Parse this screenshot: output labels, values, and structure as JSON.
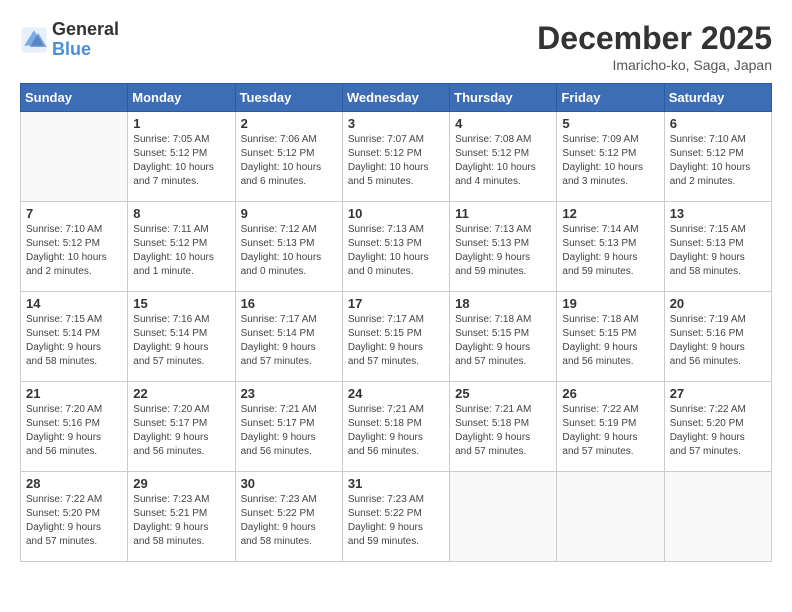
{
  "header": {
    "logo_line1": "General",
    "logo_line2": "Blue",
    "month_year": "December 2025",
    "location": "Imaricho-ko, Saga, Japan"
  },
  "weekdays": [
    "Sunday",
    "Monday",
    "Tuesday",
    "Wednesday",
    "Thursday",
    "Friday",
    "Saturday"
  ],
  "weeks": [
    [
      {
        "day": "",
        "info": ""
      },
      {
        "day": "1",
        "info": "Sunrise: 7:05 AM\nSunset: 5:12 PM\nDaylight: 10 hours\nand 7 minutes."
      },
      {
        "day": "2",
        "info": "Sunrise: 7:06 AM\nSunset: 5:12 PM\nDaylight: 10 hours\nand 6 minutes."
      },
      {
        "day": "3",
        "info": "Sunrise: 7:07 AM\nSunset: 5:12 PM\nDaylight: 10 hours\nand 5 minutes."
      },
      {
        "day": "4",
        "info": "Sunrise: 7:08 AM\nSunset: 5:12 PM\nDaylight: 10 hours\nand 4 minutes."
      },
      {
        "day": "5",
        "info": "Sunrise: 7:09 AM\nSunset: 5:12 PM\nDaylight: 10 hours\nand 3 minutes."
      },
      {
        "day": "6",
        "info": "Sunrise: 7:10 AM\nSunset: 5:12 PM\nDaylight: 10 hours\nand 2 minutes."
      }
    ],
    [
      {
        "day": "7",
        "info": "Sunrise: 7:10 AM\nSunset: 5:12 PM\nDaylight: 10 hours\nand 2 minutes."
      },
      {
        "day": "8",
        "info": "Sunrise: 7:11 AM\nSunset: 5:12 PM\nDaylight: 10 hours\nand 1 minute."
      },
      {
        "day": "9",
        "info": "Sunrise: 7:12 AM\nSunset: 5:13 PM\nDaylight: 10 hours\nand 0 minutes."
      },
      {
        "day": "10",
        "info": "Sunrise: 7:13 AM\nSunset: 5:13 PM\nDaylight: 10 hours\nand 0 minutes."
      },
      {
        "day": "11",
        "info": "Sunrise: 7:13 AM\nSunset: 5:13 PM\nDaylight: 9 hours\nand 59 minutes."
      },
      {
        "day": "12",
        "info": "Sunrise: 7:14 AM\nSunset: 5:13 PM\nDaylight: 9 hours\nand 59 minutes."
      },
      {
        "day": "13",
        "info": "Sunrise: 7:15 AM\nSunset: 5:13 PM\nDaylight: 9 hours\nand 58 minutes."
      }
    ],
    [
      {
        "day": "14",
        "info": "Sunrise: 7:15 AM\nSunset: 5:14 PM\nDaylight: 9 hours\nand 58 minutes."
      },
      {
        "day": "15",
        "info": "Sunrise: 7:16 AM\nSunset: 5:14 PM\nDaylight: 9 hours\nand 57 minutes."
      },
      {
        "day": "16",
        "info": "Sunrise: 7:17 AM\nSunset: 5:14 PM\nDaylight: 9 hours\nand 57 minutes."
      },
      {
        "day": "17",
        "info": "Sunrise: 7:17 AM\nSunset: 5:15 PM\nDaylight: 9 hours\nand 57 minutes."
      },
      {
        "day": "18",
        "info": "Sunrise: 7:18 AM\nSunset: 5:15 PM\nDaylight: 9 hours\nand 57 minutes."
      },
      {
        "day": "19",
        "info": "Sunrise: 7:18 AM\nSunset: 5:15 PM\nDaylight: 9 hours\nand 56 minutes."
      },
      {
        "day": "20",
        "info": "Sunrise: 7:19 AM\nSunset: 5:16 PM\nDaylight: 9 hours\nand 56 minutes."
      }
    ],
    [
      {
        "day": "21",
        "info": "Sunrise: 7:20 AM\nSunset: 5:16 PM\nDaylight: 9 hours\nand 56 minutes."
      },
      {
        "day": "22",
        "info": "Sunrise: 7:20 AM\nSunset: 5:17 PM\nDaylight: 9 hours\nand 56 minutes."
      },
      {
        "day": "23",
        "info": "Sunrise: 7:21 AM\nSunset: 5:17 PM\nDaylight: 9 hours\nand 56 minutes."
      },
      {
        "day": "24",
        "info": "Sunrise: 7:21 AM\nSunset: 5:18 PM\nDaylight: 9 hours\nand 56 minutes."
      },
      {
        "day": "25",
        "info": "Sunrise: 7:21 AM\nSunset: 5:18 PM\nDaylight: 9 hours\nand 57 minutes."
      },
      {
        "day": "26",
        "info": "Sunrise: 7:22 AM\nSunset: 5:19 PM\nDaylight: 9 hours\nand 57 minutes."
      },
      {
        "day": "27",
        "info": "Sunrise: 7:22 AM\nSunset: 5:20 PM\nDaylight: 9 hours\nand 57 minutes."
      }
    ],
    [
      {
        "day": "28",
        "info": "Sunrise: 7:22 AM\nSunset: 5:20 PM\nDaylight: 9 hours\nand 57 minutes."
      },
      {
        "day": "29",
        "info": "Sunrise: 7:23 AM\nSunset: 5:21 PM\nDaylight: 9 hours\nand 58 minutes."
      },
      {
        "day": "30",
        "info": "Sunrise: 7:23 AM\nSunset: 5:22 PM\nDaylight: 9 hours\nand 58 minutes."
      },
      {
        "day": "31",
        "info": "Sunrise: 7:23 AM\nSunset: 5:22 PM\nDaylight: 9 hours\nand 59 minutes."
      },
      {
        "day": "",
        "info": ""
      },
      {
        "day": "",
        "info": ""
      },
      {
        "day": "",
        "info": ""
      }
    ]
  ]
}
